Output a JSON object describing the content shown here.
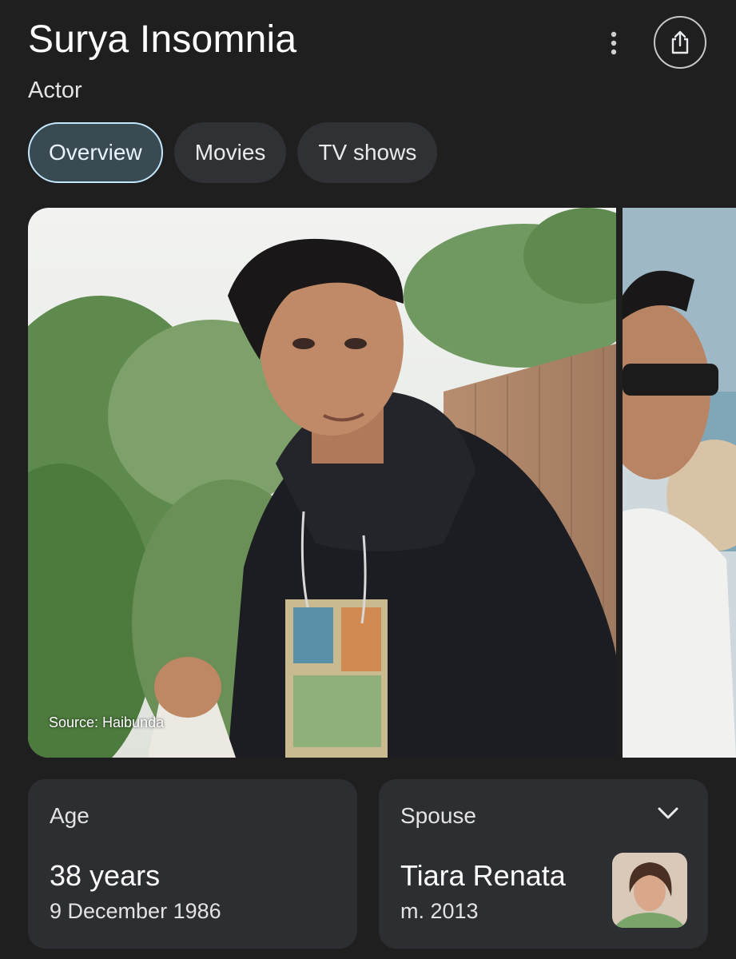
{
  "header": {
    "title": "Surya Insomnia",
    "subtitle": "Actor",
    "more_icon": "more-vert-icon",
    "share_icon": "share-icon"
  },
  "tabs": [
    {
      "label": "Overview",
      "active": true
    },
    {
      "label": "Movies",
      "active": false
    },
    {
      "label": "TV shows",
      "active": false
    }
  ],
  "gallery": {
    "source": "Source: Haibunda"
  },
  "facts": {
    "age": {
      "label": "Age",
      "value": "38 years",
      "detail": "9 December 1986"
    },
    "spouse": {
      "label": "Spouse",
      "value": "Tiara Renata",
      "detail": "m. 2013",
      "expand_icon": "chevron-down-icon"
    }
  },
  "colors": {
    "background": "#1f1f1f",
    "card": "#2d2e31",
    "tab": "#303134",
    "tab_active_fill": "#3a4a52",
    "tab_active_border": "#c2e7ff"
  }
}
